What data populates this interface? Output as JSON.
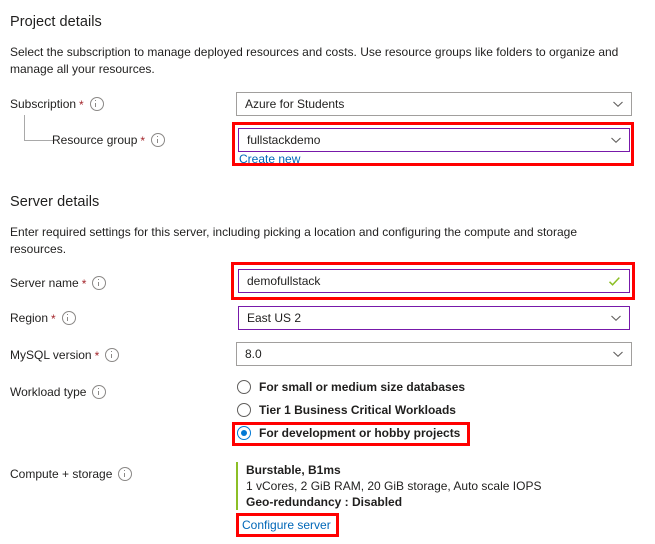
{
  "project": {
    "heading": "Project details",
    "description": "Select the subscription to manage deployed resources and costs. Use resource groups like folders to organize and manage all your resources.",
    "subscription": {
      "label": "Subscription",
      "required": "*",
      "value": "Azure for Students"
    },
    "resource_group": {
      "label": "Resource group",
      "required": "*",
      "value": "fullstackdemo",
      "create_new_link": "Create new"
    }
  },
  "server": {
    "heading": "Server details",
    "description": "Enter required settings for this server, including picking a location and configuring the compute and storage resources.",
    "server_name": {
      "label": "Server name",
      "required": "*",
      "value": "demofullstack",
      "validation": "valid"
    },
    "region": {
      "label": "Region",
      "required": "*",
      "value": "East US 2"
    },
    "mysql_version": {
      "label": "MySQL version",
      "required": "*",
      "value": "8.0"
    },
    "workload_type": {
      "label": "Workload type",
      "options": [
        {
          "label": "For small or medium size databases",
          "selected": false
        },
        {
          "label": "Tier 1 Business Critical Workloads",
          "selected": false
        },
        {
          "label": "For development or hobby projects",
          "selected": true
        }
      ]
    },
    "compute_storage": {
      "label": "Compute + storage",
      "tier": "Burstable, B1ms",
      "specs": "1 vCores, 2 GiB RAM, 20 GiB storage, Auto scale IOPS",
      "geo_redundancy": "Geo-redundancy : Disabled",
      "configure_link": "Configure server"
    }
  },
  "colors": {
    "annotation": "#ff0000",
    "focus_border": "#7719aa",
    "link": "#0067b8",
    "required": "#a4262c",
    "radio_selected": "#0078d4",
    "valid_check": "#8cbf26",
    "accent_bar": "#8cbf26"
  },
  "icons": {
    "info": "info-icon",
    "chevron": "chevron-down-icon",
    "check": "check-icon"
  }
}
